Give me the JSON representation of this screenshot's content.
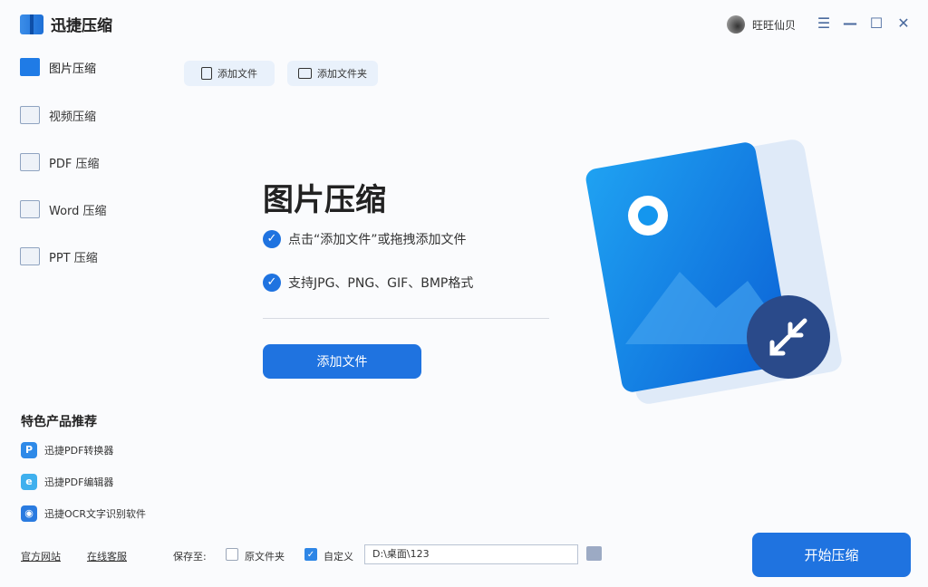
{
  "app": {
    "title": "迅捷压缩"
  },
  "user": {
    "name": "旺旺仙贝"
  },
  "window": {
    "menu": "☰",
    "minimize": "—",
    "maximize": "☐",
    "close": "✕"
  },
  "nav": [
    {
      "label": "图片压缩",
      "active": true
    },
    {
      "label": "视频压缩"
    },
    {
      "label": "PDF 压缩"
    },
    {
      "label": "Word 压缩"
    },
    {
      "label": "PPT 压缩"
    }
  ],
  "toolbar": {
    "add_file": "添加文件",
    "add_folder": "添加文件夹"
  },
  "main": {
    "title": "图片压缩",
    "features": [
      "点击“添加文件”或拖拽添加文件",
      "支持JPG、PNG、GIF、BMP格式"
    ],
    "add_button": "添加文件"
  },
  "recommend": {
    "title": "特色产品推荐",
    "items": [
      {
        "label": "迅捷PDF转换器",
        "icon": "P"
      },
      {
        "label": "迅捷PDF编辑器",
        "icon": "e"
      },
      {
        "label": "迅捷OCR文字识别软件",
        "icon": "◉"
      }
    ]
  },
  "footer": {
    "official_site": "官方网站",
    "online_service": "在线客服",
    "save_to": "保存至:",
    "original_folder": "原文件夹",
    "original_checked": false,
    "custom": "自定义",
    "custom_checked": true,
    "path": "D:\\桌面\\123",
    "start": "开始压缩"
  },
  "colors": {
    "accent": "#1f73e0"
  }
}
